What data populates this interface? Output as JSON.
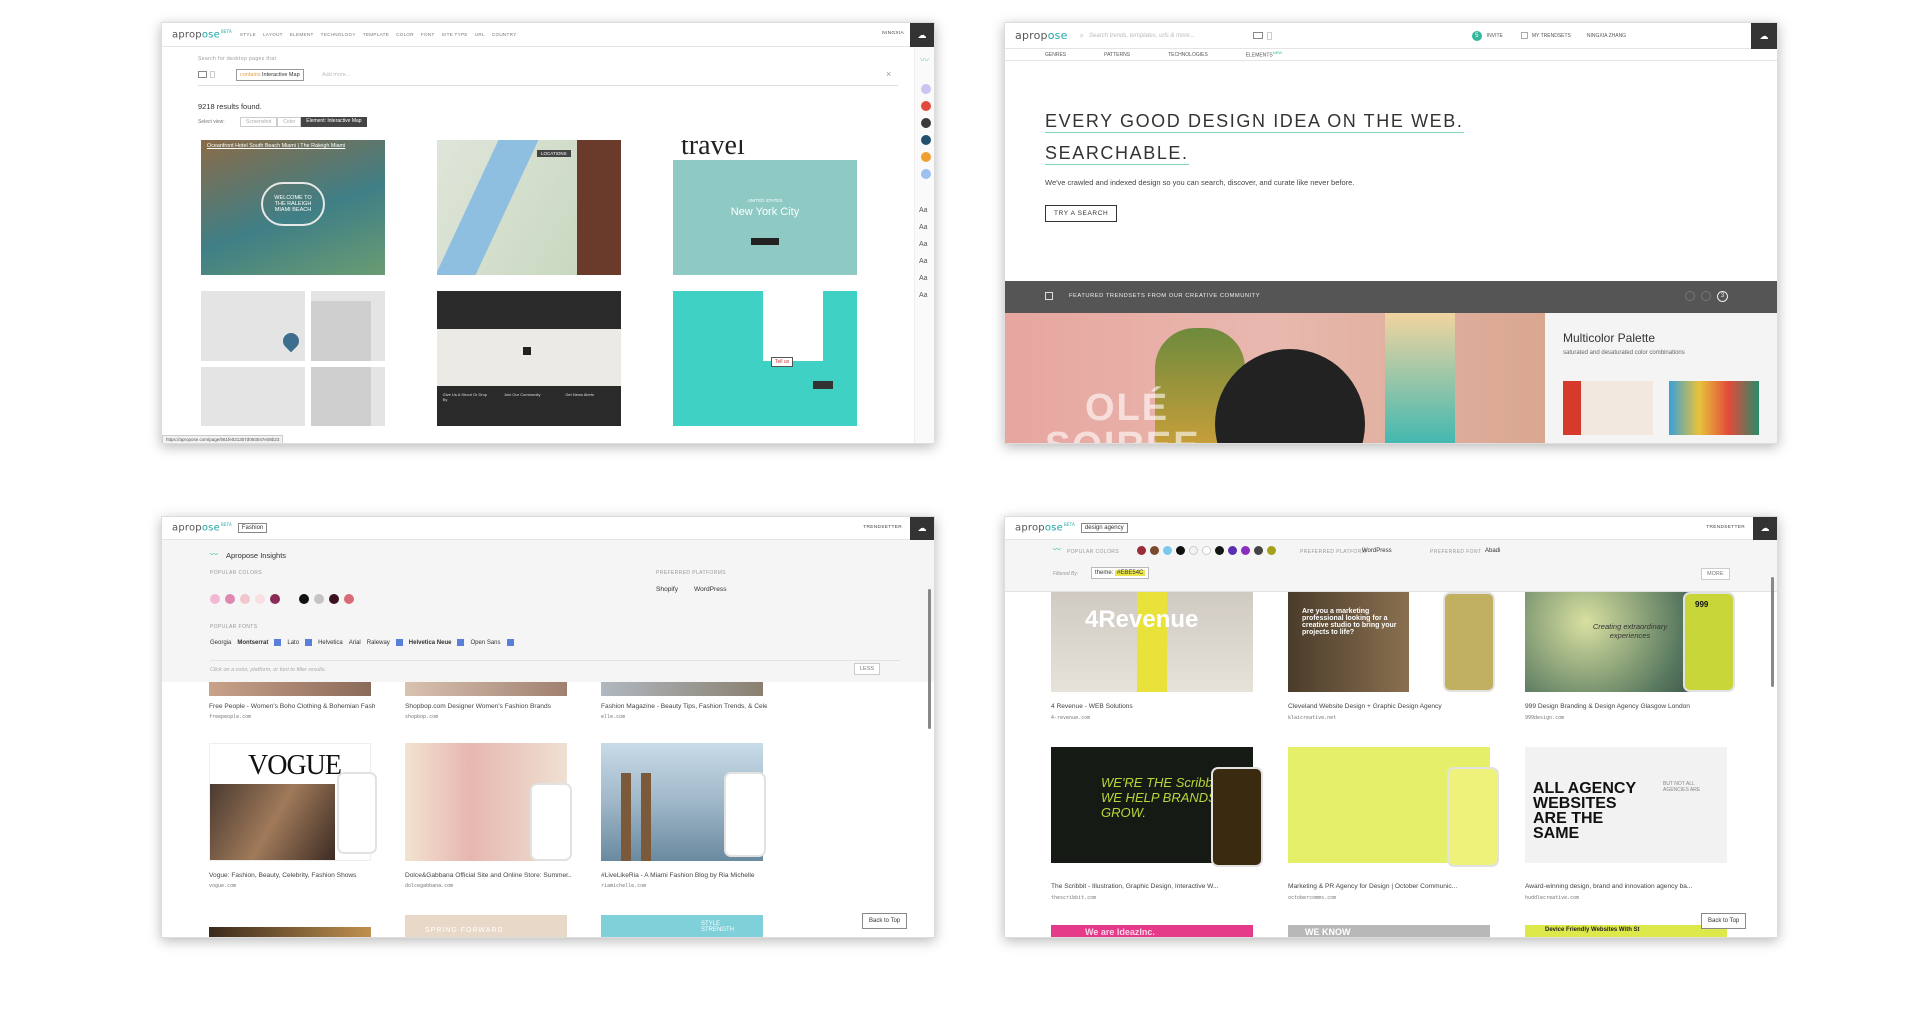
{
  "w1": {
    "logo_a": "aprop",
    "logo_b": "ose",
    "beta": "BETA",
    "nav": [
      "STYLE",
      "LAYOUT",
      "ELEMENT",
      "TECHNOLOGY",
      "TEMPLATE",
      "COLOR",
      "FONT",
      "SITE TYPE",
      "URL",
      "COUNTRY"
    ],
    "user": "NINGXIA",
    "search_label": "Search for desktop pages that",
    "tag_prefix": "contains",
    "tag_value": "Interactive Map",
    "add_more": "Add more...",
    "close": "×",
    "results": "9218 results found.",
    "select_view": "Select view:",
    "views": [
      "Screenshot",
      "Color",
      "Element: Interactive Map"
    ],
    "thumb1_title": "Oceanfront Hotel South Beach Miami | The Raleigh Miami",
    "thumb1_text": "WELCOME TO THE RALEIGH MIAMI BEACH",
    "thumb2_label": "LOCATIONS",
    "thumb3_top": "travel",
    "thumb3_city": "New York City",
    "thumb3_sub": "UNITED STATES",
    "thumb5_cols": [
      "Give Us A Shout Or Drop By",
      "Join Our Community",
      "Get News Alerts"
    ],
    "thumb6_btn": "Tell us",
    "status_url": "https://apropose.com/page/561fe021307d093047e08b23",
    "colors": [
      "#c8c6f0",
      "#e44a3a",
      "#3b3b3b",
      "#23506e",
      "#f0a030",
      "#9cc0ef"
    ],
    "aa": [
      "Aa",
      "Aa",
      "Aa",
      "Aa",
      "Aa",
      "Aa"
    ]
  },
  "w2": {
    "logo_a": "aprop",
    "logo_b": "ose",
    "search_placeholder": "Search trends, templates, urls & more...",
    "invite_count": "5",
    "invite": "INVITE",
    "my_trendsets": "MY TRENDSETS",
    "user": "NINGXIA ZHANG",
    "subnav": [
      "GENRES",
      "PATTERNS",
      "TECHNOLOGIES",
      "ELEMENTS"
    ],
    "new_badge": "NEW",
    "hero_line1": "EVERY GOOD DESIGN IDEA ON THE WEB.",
    "hero_line2": "SEARCHABLE.",
    "hero_body": "We've crawled and indexed design so you can search, discover, and curate like never before.",
    "cta": "TRY A SEARCH",
    "featured": "FEATURED TRENDSETS FROM OUR CREATIVE COMMUNITY",
    "page_num": "3",
    "banner_word1": "OLÉ",
    "banner_word2": "SOIREE",
    "card_title": "Multicolor Palette",
    "card_desc": "saturated and desaturated color combinations"
  },
  "w3": {
    "logo_a": "aprop",
    "logo_b": "ose",
    "beta": "BETA",
    "filter_tag": "Fashion",
    "user": "TRENDSETTER",
    "insights": "Apropose Insights",
    "popular_colors": "POPULAR COLORS",
    "colors": [
      "#f0b8d2",
      "#df88b0",
      "#f2c7cc",
      "#f7dfe2",
      "#8a2b56",
      "#111111",
      "#c7c2c4",
      "#3b1020",
      "#d96a78"
    ],
    "preferred_platforms": "PREFERRED PLATFORMS",
    "platforms": [
      "Shopify",
      "WordPress"
    ],
    "popular_fonts": "POPULAR FONTS",
    "fonts": [
      "Georgia",
      "Montserrat",
      "Lato",
      "Helvetica",
      "Arial",
      "Raleway",
      "Helvetica Neue",
      "Open Sans"
    ],
    "hint": "Click on a color, platform, or font to filter results.",
    "less": "LESS",
    "items": [
      {
        "title": "Free People - Women's Boho Clothing & Bohemian Fash...",
        "url": "freepeople.com"
      },
      {
        "title": "Shopbop.com Designer Women's Fashion Brands",
        "url": "shopbop.com"
      },
      {
        "title": "Fashion Magazine - Beauty Tips, Fashion Trends, & Cele...",
        "url": "elle.com"
      },
      {
        "title": "Vogue: Fashion, Beauty, Celebrity, Fashion Shows",
        "url": "vogue.com"
      },
      {
        "title": "Dolce&Gabbana Official Site and Online Store: Summer...",
        "url": "dolcegabbana.com"
      },
      {
        "title": "#LiveLikeRia - A Miami Fashion Blog by Ria Michelle",
        "url": "riamichelle.com"
      }
    ],
    "vogue": "VOGUE",
    "bottom2": "SPRING FORWARD",
    "bottom3": "STYLE STRENGTH",
    "back_to_top": "Back to Top"
  },
  "w4": {
    "logo_a": "aprop",
    "logo_b": "ose",
    "beta": "BETA",
    "filter_tag": "design agency",
    "user": "TRENDSETTER",
    "popular_colors": "POPULAR COLORS",
    "colors": [
      "#9b2d3a",
      "#7a4a2e",
      "#79c8ee",
      "#111111",
      "#f3f3f3",
      "#ffffff",
      "#151515",
      "#5a2fb0",
      "#8b2cc0",
      "#444444",
      "#a5a21a"
    ],
    "preferred_platform": "PREFERRED PLATFORM",
    "platform": "WordPress",
    "preferred_font": "PREFERRED FONT",
    "font": "Abadi",
    "filtered_by": "Filtered By:",
    "theme": "theme:",
    "theme_value": "#EBE54C",
    "more": "MORE",
    "items": [
      {
        "title": "4 Revenue - WEB Solutions",
        "url": "4-revenue.com"
      },
      {
        "title": "Cleveland Website Design + Graphic Design Agency",
        "url": "klaicreative.net"
      },
      {
        "title": "999 Design Branding & Design Agency Glasgow London",
        "url": "999design.com"
      },
      {
        "title": "The Scribbit - Illustration, Graphic Design, Interactive W...",
        "url": "thescribbit.com"
      },
      {
        "title": "Marketing & PR Agency for Design | October Communic...",
        "url": "octobercomms.com"
      },
      {
        "title": "Award-winning design, brand and innovation agency ba...",
        "url": "huddlecreative.com"
      }
    ],
    "t1_text": "4Revenue",
    "t2_text": "Are you a marketing professional looking for a creative studio to bring your projects to life?",
    "t3_text": "Creating extraordinary experiences",
    "t3_badge": "999",
    "t4_text": "WE'RE THE Scribbit WE HELP BRANDS GROW.",
    "t6_text": "ALL AGENCY WEBSITES ARE THE SAME",
    "t6_side": "BUT NOT ALL AGENCIES ARE",
    "b1_text": "We are IdeazInc.",
    "b2_text": "WE KNOW",
    "b3_text": "Device Friendly Websites With St",
    "back_to_top": "Back to Top"
  }
}
